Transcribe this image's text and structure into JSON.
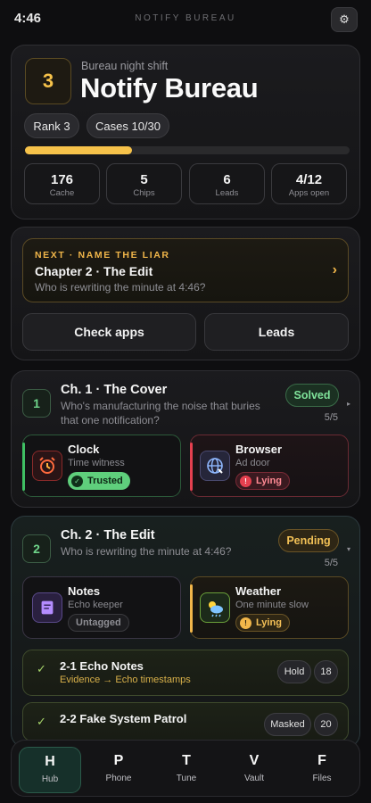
{
  "status": {
    "time": "4:46",
    "app_caption": "NOTIFY BUREAU",
    "settings_icon": "gear-icon"
  },
  "header": {
    "level": "3",
    "subtitle": "Bureau night shift",
    "title": "Notify Bureau",
    "rank": "Rank 3",
    "cases": "Cases 10/30",
    "progress": 0.33,
    "progress_color": "#f6c24a",
    "stats": [
      {
        "value": "176",
        "label": "Cache"
      },
      {
        "value": "5",
        "label": "Chips"
      },
      {
        "value": "6",
        "label": "Leads"
      },
      {
        "value": "4/12",
        "label": "Apps open"
      }
    ]
  },
  "next": {
    "tag": "NEXT · NAME THE LIAR",
    "title": "Chapter 2 · The Edit",
    "subtitle": "Who is rewriting the minute at 4:46?",
    "arrow": "›",
    "buttons": {
      "check_apps": "Check apps",
      "leads": "Leads"
    }
  },
  "chapters": [
    {
      "num": "1",
      "title": "Ch. 1 · The Cover",
      "subtitle": "Who's manufacturing the noise that buries that one notification?",
      "badge": "Solved",
      "count": "5/5",
      "caret": "▸",
      "apps": [
        {
          "name": "Clock",
          "role": "Time witness",
          "tag": "Trusted",
          "tag_icon": "✓",
          "icon": "alarm-clock-icon"
        },
        {
          "name": "Browser",
          "role": "Ad door",
          "tag": "Lying",
          "tag_icon": "!",
          "icon": "globe-icon"
        }
      ]
    },
    {
      "num": "2",
      "title": "Ch. 2 · The Edit",
      "subtitle": "Who is rewriting the minute at 4:46?",
      "badge": "Pending",
      "count": "5/5",
      "caret": "▾",
      "apps": [
        {
          "name": "Notes",
          "role": "Echo keeper",
          "tag": "Untagged",
          "icon": "notes-icon"
        },
        {
          "name": "Weather",
          "role": "One minute slow",
          "tag": "Lying",
          "tag_icon": "!",
          "icon": "weather-icon"
        }
      ],
      "evidence": [
        {
          "check": "✓",
          "title": "2-1 Echo Notes",
          "sub": "Evidence → Echo timestamps",
          "pill": "Hold",
          "count": "18"
        },
        {
          "check": "✓",
          "title": "2-2 Fake System Patrol",
          "sub": "",
          "pill": "Masked",
          "count": "20"
        }
      ]
    }
  ],
  "nav": [
    {
      "letter": "H",
      "label": "Hub",
      "active": true
    },
    {
      "letter": "P",
      "label": "Phone"
    },
    {
      "letter": "T",
      "label": "Tune"
    },
    {
      "letter": "V",
      "label": "Vault"
    },
    {
      "letter": "F",
      "label": "Files"
    }
  ]
}
